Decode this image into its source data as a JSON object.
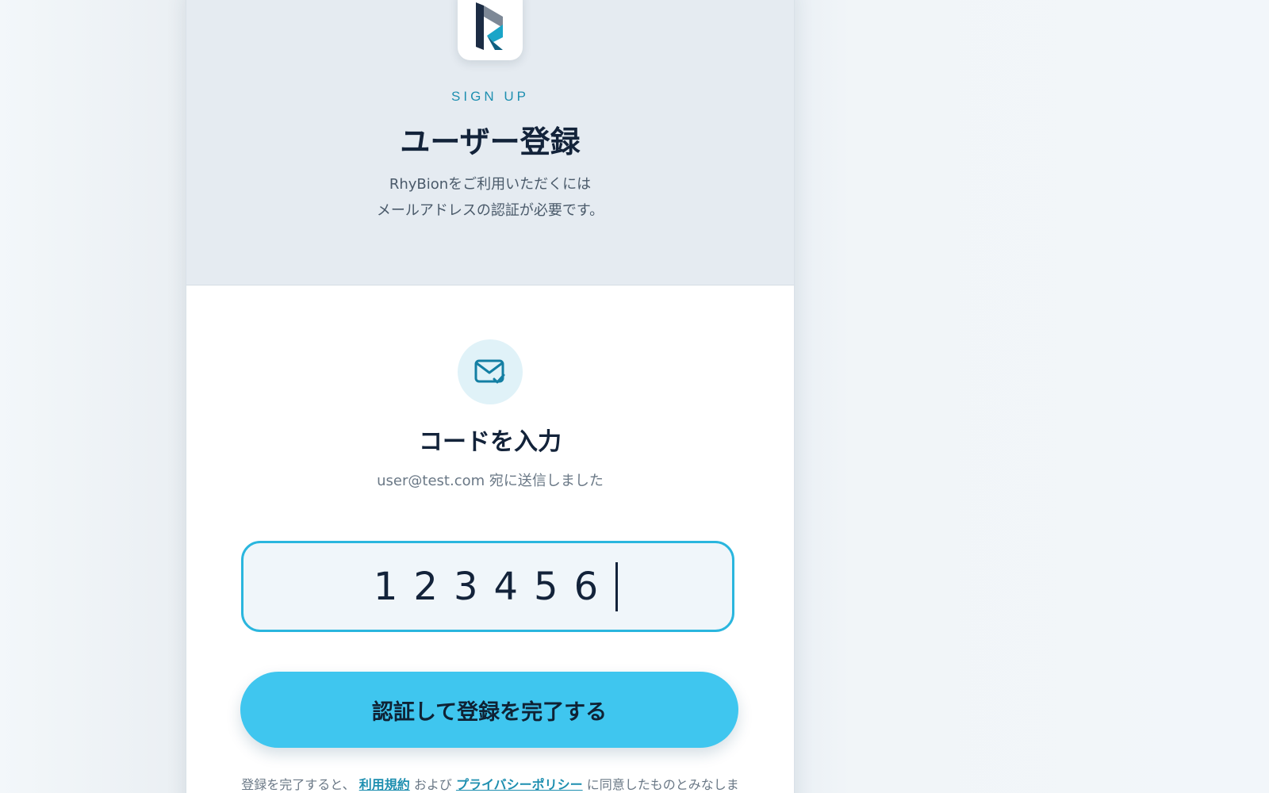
{
  "header": {
    "eyebrow": "SIGN UP",
    "title": "ユーザー登録",
    "subtitle_line1": "RhyBionをご利用いただくには",
    "subtitle_line2": "メールアドレスの認証が必要です。"
  },
  "verify": {
    "title": "コードを入力",
    "sent_to": "user@test.com 宛に送信しました",
    "code_value": "123456",
    "submit_label": "認証して登録を完了する"
  },
  "terms": {
    "prefix": "登録を完了すると、",
    "terms_link": "利用規約",
    "middle": "および",
    "privacy_link": "プライバシーポリシー",
    "suffix": "に同意したものとみなしま"
  },
  "icons": {
    "logo": "rhybion-logo",
    "mail": "mail-check-icon"
  },
  "colors": {
    "accent": "#3fc6ef",
    "accent_text": "#1e8fb0",
    "header_bg": "#e5ebf1",
    "input_border": "#2ab6de"
  }
}
